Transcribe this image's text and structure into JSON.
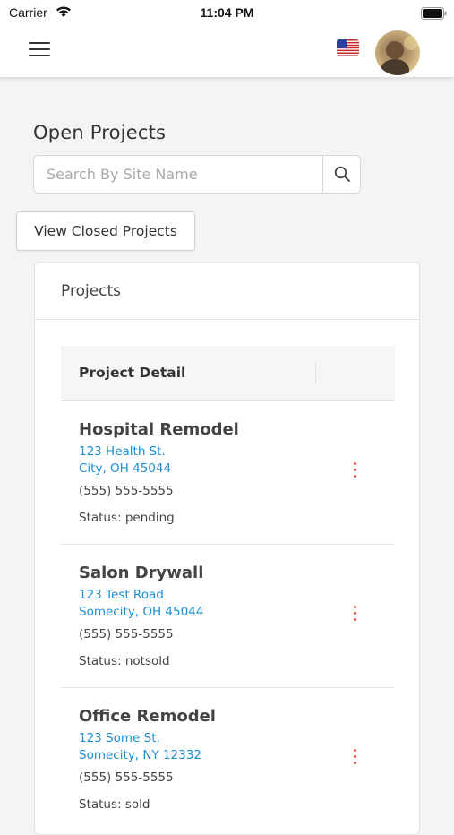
{
  "status_bar": {
    "carrier": "Carrier",
    "time": "11:04 PM"
  },
  "nav": {
    "menu_icon": "hamburger-menu-icon",
    "flag_icon": "us-flag-icon",
    "avatar": "user-avatar"
  },
  "page": {
    "title": "Open Projects"
  },
  "search": {
    "placeholder": "Search By Site Name",
    "value": "",
    "icon": "search-icon"
  },
  "closed_button": {
    "label": "View Closed Projects"
  },
  "card": {
    "title": "Projects",
    "table_header": "Project Detail",
    "rows": [
      {
        "name": "Hospital Remodel",
        "address_line1": "123 Health St.",
        "address_line2": "City, OH 45044",
        "phone": "(555) 555-5555",
        "status": "Status: pending"
      },
      {
        "name": "Salon Drywall",
        "address_line1": "123 Test Road",
        "address_line2": "Somecity, OH 45044",
        "phone": "(555) 555-5555",
        "status": "Status: notsold"
      },
      {
        "name": "Office Remodel",
        "address_line1": "123 Some St.",
        "address_line2": "Somecity, NY 12332",
        "phone": "(555) 555-5555",
        "status": "Status: sold"
      }
    ]
  },
  "colors": {
    "accent_link": "#1d8fd1",
    "menu_dots": "#e53935",
    "background": "#f4f4f4"
  }
}
